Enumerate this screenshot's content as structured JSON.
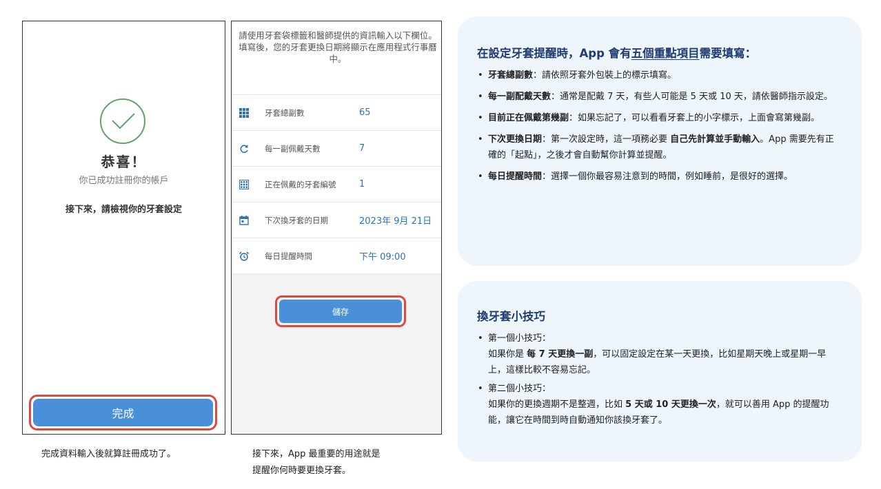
{
  "phone1": {
    "congrats": "恭喜！",
    "registered": "你已成功註冊你的帳戶",
    "next_check": "接下來，請檢視你的牙套設定",
    "done_button": "完成"
  },
  "caption1": "完成資料輸入後就算註冊成功了。",
  "phone2": {
    "intro": "請使用牙套袋標籤和醫師提供的資訊輸入以下欄位。填寫後，您的牙套更換日期將顯示在應用程式行事曆中。",
    "rows": [
      {
        "icon": "grid-icon",
        "label": "牙套總副數",
        "value": "65"
      },
      {
        "icon": "refresh-icon",
        "label": "每一副佩戴天數",
        "value": "7"
      },
      {
        "icon": "number-grid-icon",
        "label": "正在佩戴的牙套編號",
        "value": "1"
      },
      {
        "icon": "calendar-icon",
        "label": "下次換牙套的日期",
        "value": "2023年 9月 21日"
      },
      {
        "icon": "alarm-clock-icon",
        "label": "每日提醒時間",
        "value": "下午 09:00"
      }
    ],
    "save_button": "儲存"
  },
  "caption2": {
    "line1": "接下來，App 最重要的用途就是",
    "line2": "提醒你何時要更換牙套。"
  },
  "card1": {
    "title_pre": "在設定牙套提醒時，App 會有",
    "title_underline": "五個重點項目",
    "title_post": "需要填寫：",
    "items": [
      {
        "bold": "牙套總副數",
        "text": "：請依照牙套外包裝上的標示填寫。"
      },
      {
        "bold": "每一副配戴天數",
        "text": "：通常是配戴 7 天，有些人可能是 5 天或 10 天，請依醫師指示設定。"
      },
      {
        "bold": "目前正在佩戴第幾副",
        "text": "：如果忘記了，可以看看牙套上的小字標示，上面會寫第幾副。"
      },
      {
        "bold": "下次更換日期",
        "text_a": "：第一次設定時，這一項務必要 ",
        "bold2": "自己先計算並手動輸入",
        "text_b": "。App 需要先有正確的「起點」，之後才會自動幫你計算並提醒。"
      },
      {
        "bold": "每日提醒時間",
        "text": "：選擇一個你最容易注意到的時間，例如睡前，是很好的選擇。"
      }
    ]
  },
  "card2": {
    "title": "換牙套小技巧",
    "tip1_head": "第一個小技巧：",
    "tip1_a": "如果你是 ",
    "tip1_bold": "每 7 天更換一副",
    "tip1_b": "，可以固定設定在某一天更換，比如星期天晚上或星期一早上，這樣比較不容易忘記。",
    "tip2_head": "第二個小技巧：",
    "tip2_a": "如果你的更換週期不是整週，比如 ",
    "tip2_bold": "5 天或 10 天更換一次",
    "tip2_b": "，就可以善用 App 的提醒功能，讓它在時間到時自動通知你該換牙套了。"
  },
  "colors": {
    "accent_blue": "#4a90d9",
    "highlight_red": "#d94b3d",
    "success_green": "#5fa36e",
    "card_bg": "#eef5fb",
    "title_navy": "#1f3c73"
  }
}
